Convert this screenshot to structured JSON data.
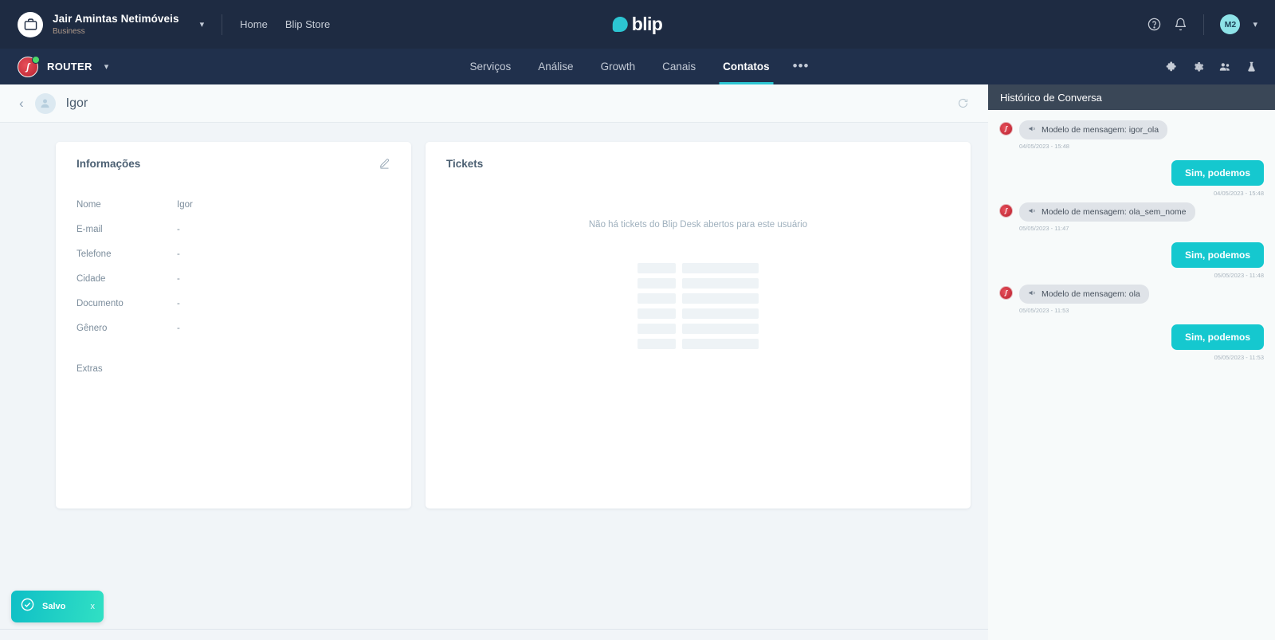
{
  "topbar": {
    "org_name": "Jair Amintas Netimóveis",
    "org_plan": "Business",
    "org_icon": "briefcase-icon",
    "org_chevron": "chevron-down-icon",
    "links": [
      {
        "label": "Home",
        "name": "home-link"
      },
      {
        "label": "Blip Store",
        "name": "blip-store-link"
      }
    ],
    "brand": "blip",
    "help_icon": "help-circle-icon",
    "bell_icon": "bell-icon",
    "avatar_initials": "M2",
    "avatar_chevron": "chevron-down-icon"
  },
  "navbar": {
    "bot_name": "ROUTER",
    "bot_chevron": "chevron-down-icon",
    "bot_status": "online",
    "tabs": [
      {
        "label": "Serviços",
        "active": false
      },
      {
        "label": "Análise",
        "active": false
      },
      {
        "label": "Growth",
        "active": false
      },
      {
        "label": "Canais",
        "active": false
      },
      {
        "label": "Contatos",
        "active": true
      }
    ],
    "overflow": "•••",
    "right_icons": [
      "puzzle-icon",
      "gear-icon",
      "people-icon",
      "flask-icon"
    ]
  },
  "page": {
    "back": "‹",
    "contact_name": "Igor",
    "refresh_icon": "refresh-icon"
  },
  "info_card": {
    "title": "Informações",
    "edit_icon": "pencil-icon",
    "fields": [
      {
        "label": "Nome",
        "value": "Igor"
      },
      {
        "label": "E-mail",
        "value": "-"
      },
      {
        "label": "Telefone",
        "value": "-"
      },
      {
        "label": "Cidade",
        "value": "-"
      },
      {
        "label": "Documento",
        "value": "-"
      },
      {
        "label": "Gênero",
        "value": "-"
      }
    ],
    "extras_label": "Extras"
  },
  "tickets_card": {
    "title": "Tickets",
    "empty_message": "Não há tickets do Blip Desk abertos para este usuário",
    "skeleton_rows": 6
  },
  "chat": {
    "title": "Histórico de Conversa",
    "messages": [
      {
        "type": "in",
        "icon": "megaphone-icon",
        "text": "Modelo de mensagem: igor_ola",
        "time": "04/05/2023 - 15:48"
      },
      {
        "type": "out",
        "text": "Sim, podemos",
        "time": "04/05/2023 - 15:48"
      },
      {
        "type": "in",
        "icon": "megaphone-icon",
        "text": "Modelo de mensagem: ola_sem_nome",
        "time": "05/05/2023 - 11:47"
      },
      {
        "type": "out",
        "text": "Sim, podemos",
        "time": "05/05/2023 - 11:48"
      },
      {
        "type": "in",
        "icon": "megaphone-icon",
        "text": "Modelo de mensagem: ola",
        "time": "05/05/2023 - 11:53"
      },
      {
        "type": "out",
        "text": "Sim, podemos",
        "time": "05/05/2023 - 11:53"
      }
    ]
  },
  "toast": {
    "label": "Salvo",
    "icon": "check-circle-icon",
    "close": "x"
  },
  "colors": {
    "topbar": "#1e2b42",
    "navbar": "#20304c",
    "accent": "#2cc5d2",
    "chat_out": "#15c8cf",
    "chat_header": "#3a4757",
    "page_bg": "#f1f5f8"
  }
}
